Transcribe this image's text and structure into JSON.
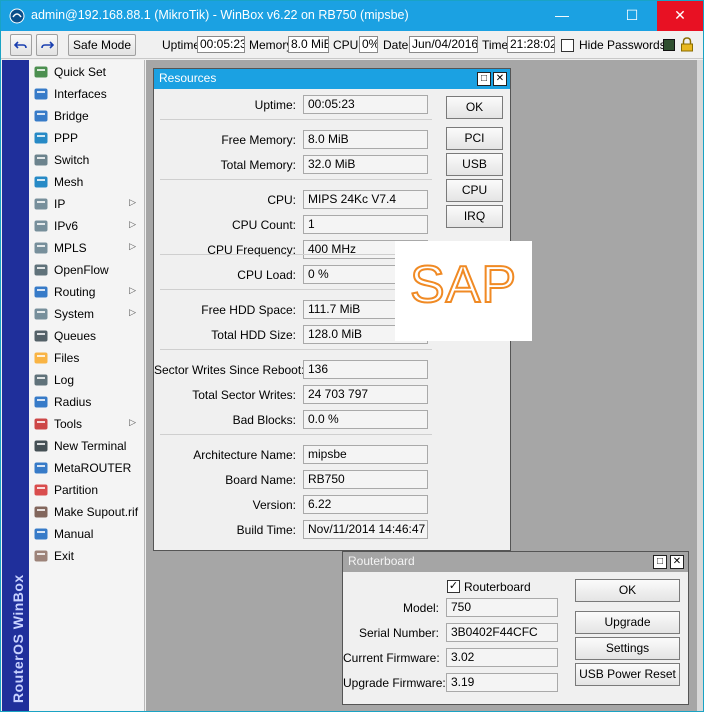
{
  "window": {
    "title": "admin@192.168.88.1 (MikroTik) - WinBox v6.22 on RB750 (mipsbe)",
    "controls": {
      "minimize": "—",
      "maximize": "☐",
      "close": "✕"
    }
  },
  "toolbar": {
    "undo_icon": "undo-icon",
    "redo_icon": "redo-icon",
    "safe_mode_label": "Safe Mode",
    "uptime_label": "Uptime:",
    "uptime_value": "00:05:23",
    "memory_label": "Memory:",
    "memory_value": "8.0 MiB",
    "cpu_label": "CPU:",
    "cpu_value": "0%",
    "date_label": "Date:",
    "date_value": "Jun/04/2016",
    "time_label": "Time:",
    "time_value": "21:28:02",
    "hide_passwords_label": "Hide Passwords",
    "hide_passwords_checked": false
  },
  "sidebar": {
    "brand": "RouterOS WinBox",
    "items": [
      {
        "label": "Quick Set",
        "icon": "quick-set-icon",
        "submenu": false
      },
      {
        "label": "Interfaces",
        "icon": "interfaces-icon",
        "submenu": false
      },
      {
        "label": "Bridge",
        "icon": "bridge-icon",
        "submenu": false
      },
      {
        "label": "PPP",
        "icon": "ppp-icon",
        "submenu": false
      },
      {
        "label": "Switch",
        "icon": "switch-icon",
        "submenu": false
      },
      {
        "label": "Mesh",
        "icon": "mesh-icon",
        "submenu": false
      },
      {
        "label": "IP",
        "icon": "ip-icon",
        "submenu": true
      },
      {
        "label": "IPv6",
        "icon": "ipv6-icon",
        "submenu": true
      },
      {
        "label": "MPLS",
        "icon": "mpls-icon",
        "submenu": true
      },
      {
        "label": "OpenFlow",
        "icon": "openflow-icon",
        "submenu": false
      },
      {
        "label": "Routing",
        "icon": "routing-icon",
        "submenu": true
      },
      {
        "label": "System",
        "icon": "system-icon",
        "submenu": true
      },
      {
        "label": "Queues",
        "icon": "queues-icon",
        "submenu": false
      },
      {
        "label": "Files",
        "icon": "files-icon",
        "submenu": false
      },
      {
        "label": "Log",
        "icon": "log-icon",
        "submenu": false
      },
      {
        "label": "Radius",
        "icon": "radius-icon",
        "submenu": false
      },
      {
        "label": "Tools",
        "icon": "tools-icon",
        "submenu": true
      },
      {
        "label": "New Terminal",
        "icon": "terminal-icon",
        "submenu": false
      },
      {
        "label": "MetaROUTER",
        "icon": "metarouter-icon",
        "submenu": false
      },
      {
        "label": "Partition",
        "icon": "partition-icon",
        "submenu": false
      },
      {
        "label": "Make Supout.rif",
        "icon": "supout-icon",
        "submenu": false
      },
      {
        "label": "Manual",
        "icon": "manual-icon",
        "submenu": false
      },
      {
        "label": "Exit",
        "icon": "exit-icon",
        "submenu": false
      }
    ],
    "submenu_arrow": "▷"
  },
  "resources": {
    "title": "Resources",
    "fields": [
      {
        "label": "Uptime:",
        "value": "00:05:23"
      },
      {
        "label": "Free Memory:",
        "value": "8.0 MiB"
      },
      {
        "label": "Total Memory:",
        "value": "32.0 MiB"
      },
      {
        "label": "CPU:",
        "value": "MIPS 24Kc V7.4"
      },
      {
        "label": "CPU Count:",
        "value": "1"
      },
      {
        "label": "CPU Frequency:",
        "value": "400 MHz"
      },
      {
        "label": "CPU Load:",
        "value": "0 %"
      },
      {
        "label": "Free HDD Space:",
        "value": "111.7 MiB"
      },
      {
        "label": "Total HDD Size:",
        "value": "128.0 MiB"
      },
      {
        "label": "Sector Writes Since Reboot:",
        "value": "136"
      },
      {
        "label": "Total Sector Writes:",
        "value": "24 703 797"
      },
      {
        "label": "Bad Blocks:",
        "value": "0.0 %"
      },
      {
        "label": "Architecture Name:",
        "value": "mipsbe"
      },
      {
        "label": "Board Name:",
        "value": "RB750"
      },
      {
        "label": "Version:",
        "value": "6.22"
      },
      {
        "label": "Build Time:",
        "value": "Nov/11/2014 14:46:47"
      }
    ],
    "buttons": {
      "ok": "OK",
      "pci": "PCI",
      "usb": "USB",
      "cpu": "CPU",
      "irq": "IRQ"
    }
  },
  "routerboard": {
    "title": "Routerboard",
    "checkbox_label": "Routerboard",
    "checkbox_checked": true,
    "fields": [
      {
        "label": "Model:",
        "value": "750"
      },
      {
        "label": "Serial Number:",
        "value": "3B0402F44CFC"
      },
      {
        "label": "Current Firmware:",
        "value": "3.02"
      },
      {
        "label": "Upgrade Firmware:",
        "value": "3.19"
      }
    ],
    "buttons": {
      "ok": "OK",
      "upgrade": "Upgrade",
      "settings": "Settings",
      "usb_power_reset": "USB Power Reset"
    }
  },
  "watermark": "SAP",
  "colors": {
    "titlebar": "#1ba1e2",
    "close": "#e81123",
    "sidebar_brand_bg": "#1f2f9b",
    "watermark": "#f08a24"
  }
}
